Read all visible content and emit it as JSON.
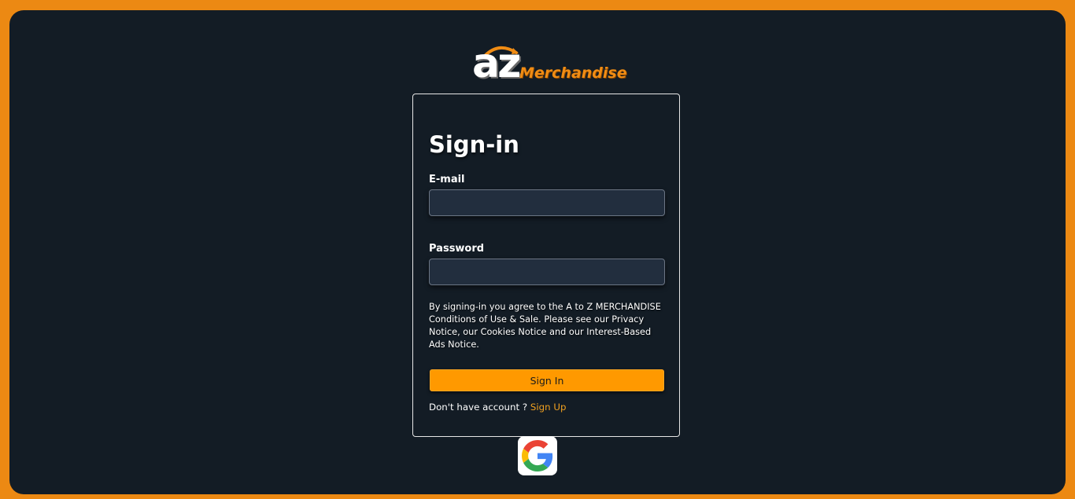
{
  "logo": {
    "brand_mark": "az",
    "brand_name": "Merchandise"
  },
  "signin": {
    "title": "Sign-in",
    "email_label": "E-mail",
    "email_value": "",
    "password_label": "Password",
    "password_value": "",
    "terms_text": "By signing-in you agree to the A to Z MERCHANDISE Conditions of Use & Sale. Please see our Privacy Notice, our Cookies Notice and our Interest-Based Ads Notice.",
    "signin_button": "Sign In",
    "no_account_text": "Don't have account ?",
    "signup_link": "Sign Up"
  },
  "social": {
    "google_icon": "google-icon"
  },
  "colors": {
    "page_border": "#ec8913",
    "background": "#131c25",
    "accent": "#ff9900",
    "input_bg": "#222e3e"
  }
}
